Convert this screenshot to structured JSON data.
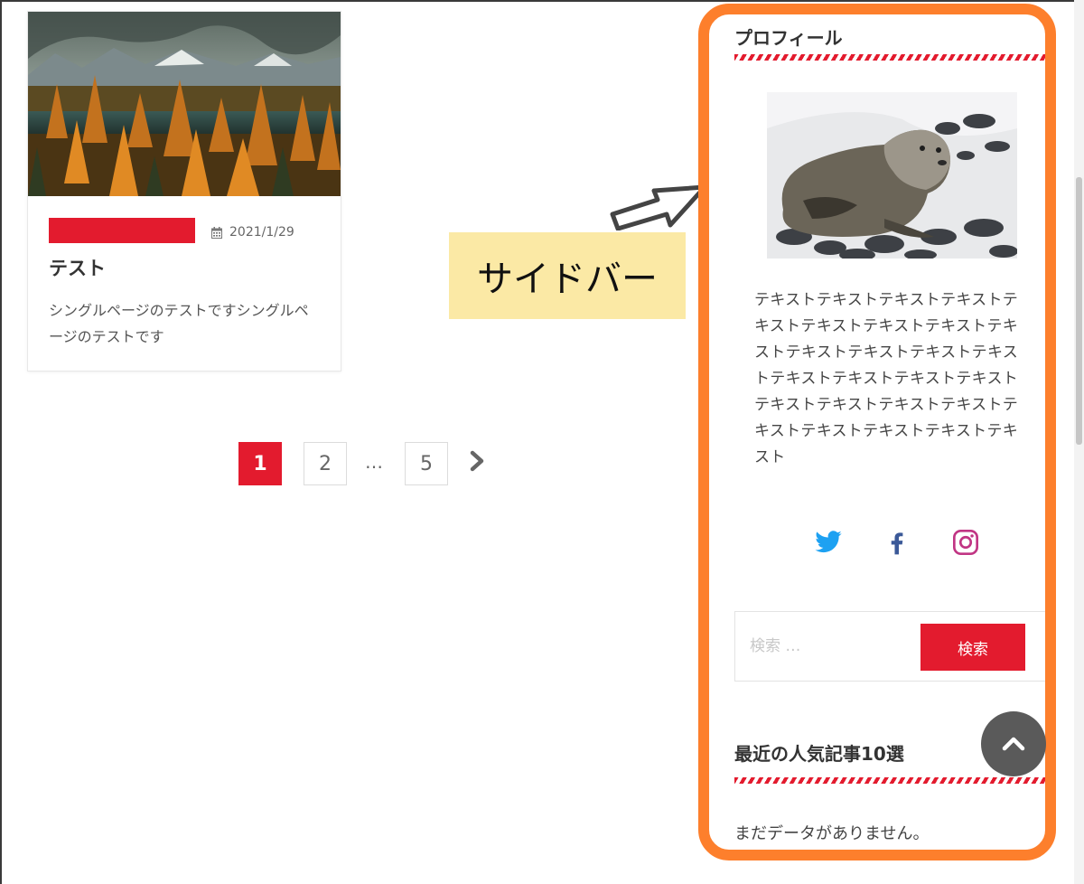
{
  "article": {
    "date": "2021/1/29",
    "title": "テスト",
    "excerpt": "シングルページのテストですシングルページのテストです"
  },
  "pagination": {
    "pages": [
      "1",
      "2",
      "5"
    ],
    "current": "1",
    "ellipsis": "…"
  },
  "annotation": {
    "label": "サイドバー"
  },
  "sidebar": {
    "profile_title": "プロフィール",
    "profile_text": "テキストテキストテキストテキストテキストテキストテキストテキストテキストテキストテキストテキストテキストテキストテキストテキストテキストテキストテキストテキストテキストテキストテキストテキストテキストテキスト",
    "social": [
      "twitter-icon",
      "facebook-icon",
      "instagram-icon"
    ],
    "search": {
      "placeholder": "検索 …",
      "button": "検索"
    },
    "popular_title": "最近の人気記事10選",
    "no_data": "まだデータがありません。"
  },
  "colors": {
    "accent": "#e31b2e",
    "sidebar_outline": "#fd7f2c",
    "annotation_bg": "#fbe9a5",
    "twitter": "#1da1f2",
    "facebook": "#3b5998",
    "instagram": "#c13584"
  }
}
